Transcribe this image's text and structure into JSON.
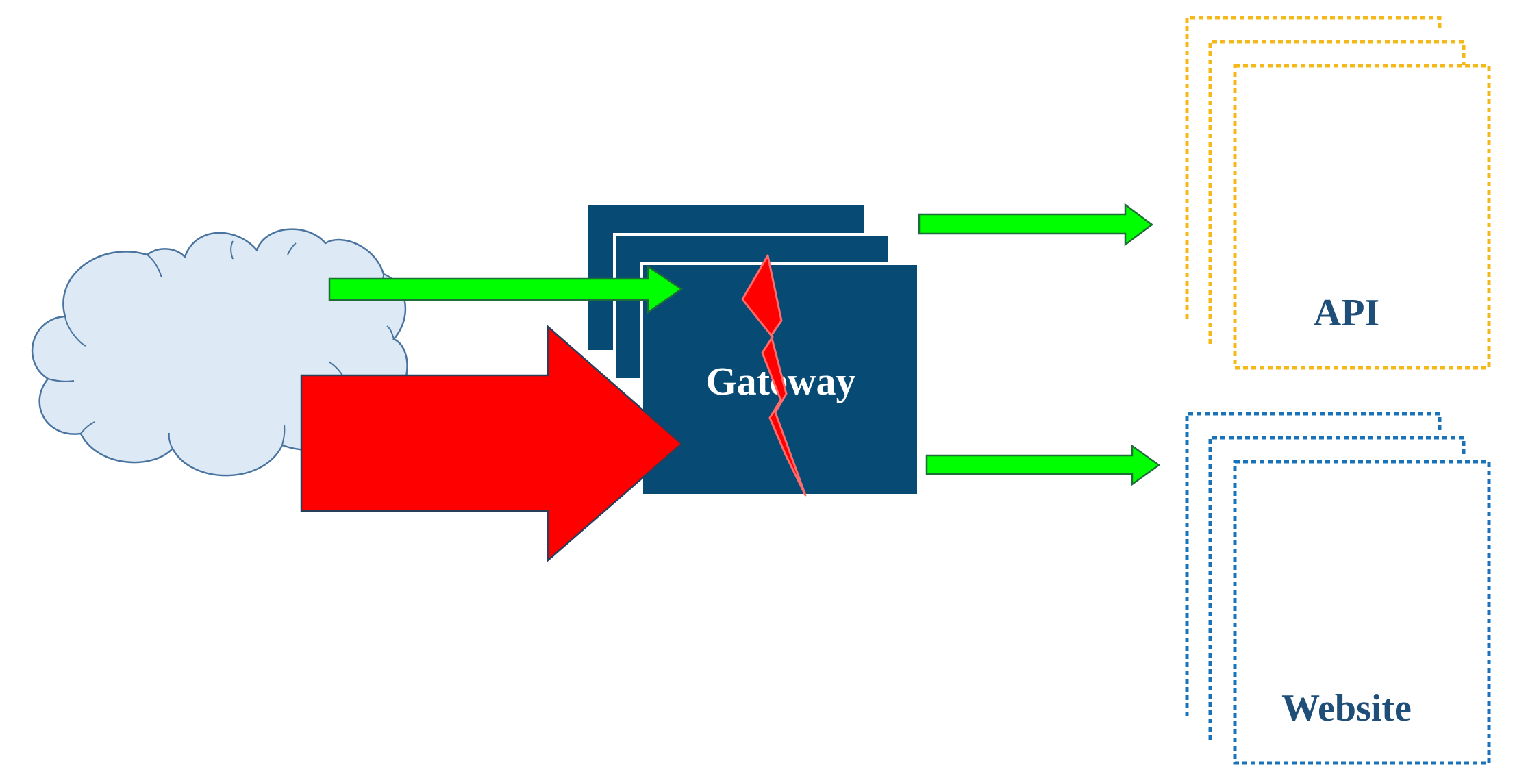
{
  "gateway": {
    "label": "Gateway"
  },
  "api": {
    "label": "API"
  },
  "website": {
    "label": "Website"
  },
  "colors": {
    "cloud_fill": "#dde9f5",
    "cloud_stroke": "#4a74a0",
    "gateway_fill": "#074a74",
    "gateway_text": "#ffffff",
    "green_arrow": "#00ff00",
    "green_arrow_stroke": "#1e6e3a",
    "red_arrow": "#ff0000",
    "red_arrow_stroke": "#2a3e5a",
    "lightning_fill": "#ff0000",
    "lightning_stroke": "#ff6b6b",
    "api_border": "#f5b819",
    "website_border": "#1a72b8",
    "label_text": "#1f4e79"
  },
  "icons": {
    "internet": "cloud-icon",
    "failure": "lightning-bolt-icon"
  }
}
